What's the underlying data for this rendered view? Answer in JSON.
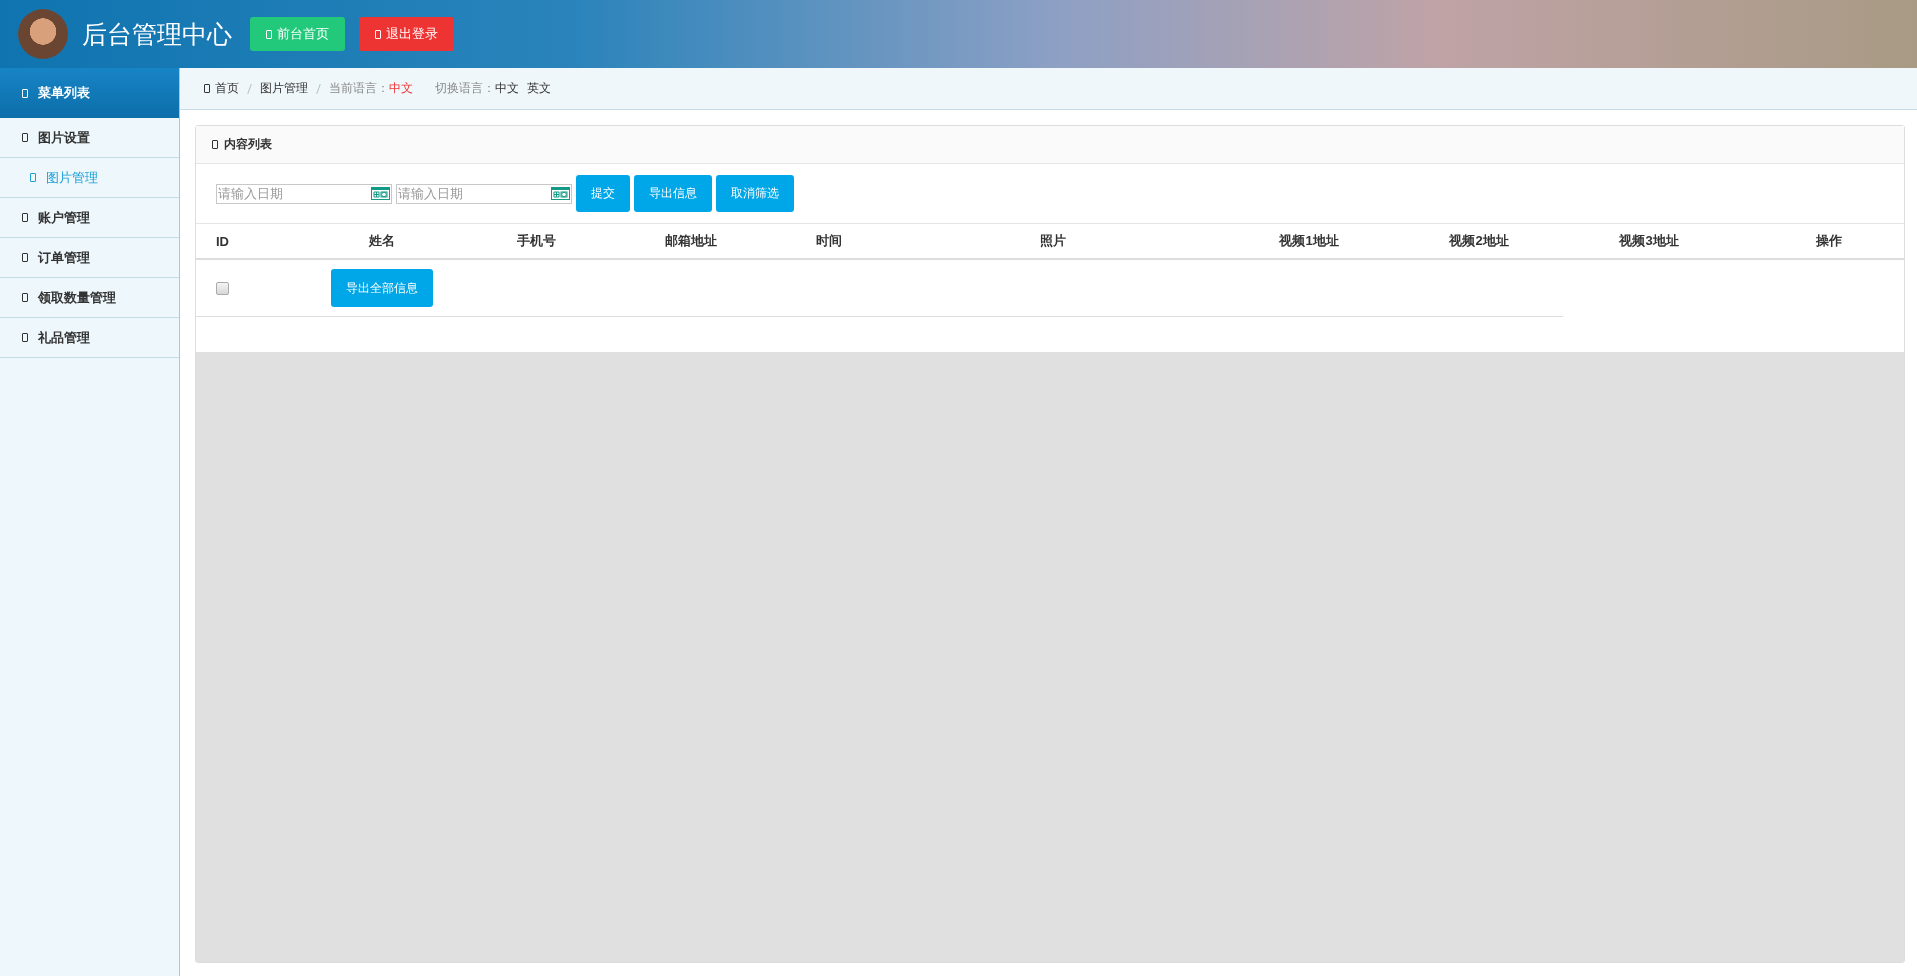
{
  "header": {
    "title": "后台管理中心",
    "buttons": [
      {
        "label": "前台首页",
        "kind": "home"
      },
      {
        "label": "退出登录",
        "kind": "logout"
      }
    ]
  },
  "sidebar": {
    "title": "菜单列表",
    "items": [
      {
        "label": "图片设置",
        "children": [
          {
            "label": "图片管理",
            "selected": true
          }
        ]
      },
      {
        "label": "账户管理"
      },
      {
        "label": "订单管理"
      },
      {
        "label": "领取数量管理"
      },
      {
        "label": "礼品管理"
      }
    ]
  },
  "breadcrumb": {
    "items": [
      "首页",
      "图片管理"
    ],
    "current_language_label": "当前语言：",
    "current_language": "中文",
    "switch_label": "切换语言：",
    "languages": [
      "中文",
      "英文"
    ]
  },
  "panel": {
    "title": "内容列表",
    "date_fields": [
      {
        "placeholder": "请输入日期"
      },
      {
        "placeholder": "请输入日期"
      }
    ],
    "buttons": [
      "提交",
      "导出信息",
      "取消筛选"
    ],
    "table": {
      "columns": [
        "ID",
        "姓名",
        "手机号",
        "邮箱地址",
        "时间",
        "照片",
        "视频1地址",
        "视频2地址",
        "视频3地址",
        "操作"
      ],
      "rows": [
        {
          "checked": false,
          "action": "导出全部信息"
        }
      ]
    }
  }
}
